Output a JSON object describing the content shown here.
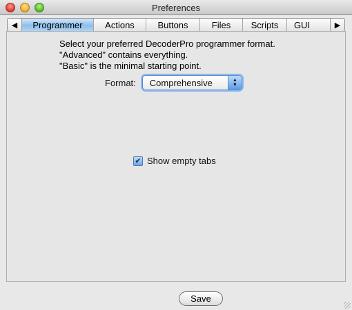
{
  "window": {
    "title": "Preferences"
  },
  "tabs": [
    {
      "label": "Programmer",
      "active": true
    },
    {
      "label": "Actions",
      "active": false
    },
    {
      "label": "Buttons",
      "active": false
    },
    {
      "label": "Files",
      "active": false
    },
    {
      "label": "Scripts",
      "active": false
    },
    {
      "label": "GUI",
      "active": false
    }
  ],
  "tab_scroll": {
    "left_glyph": "◀",
    "right_glyph": "▶"
  },
  "programmer": {
    "description_lines": [
      "Select your preferred DecoderPro programmer format.",
      "\"Advanced\" contains everything.",
      "\"Basic\" is the minimal starting point."
    ],
    "format_label": "Format:",
    "format_value": "Comprehensive",
    "show_empty_tabs_label": "Show empty tabs",
    "show_empty_tabs_checked": true
  },
  "footer": {
    "save_label": "Save"
  },
  "colors": {
    "active_tab": "#8ebee9",
    "focus_ring": "#8fb8ea"
  }
}
